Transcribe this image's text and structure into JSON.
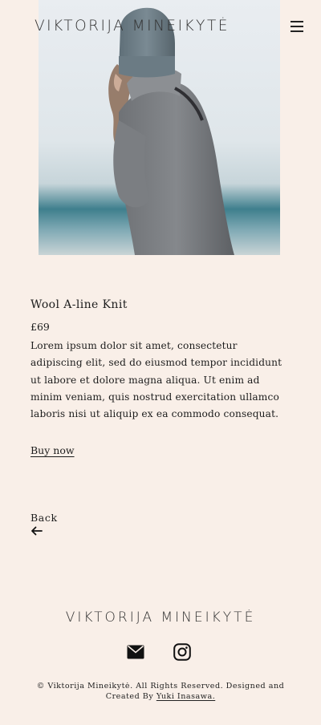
{
  "header": {
    "brand": "VIKTORIJA MINEIKYTĖ",
    "menu_icon": "hamburger-menu-icon"
  },
  "product": {
    "image_alt": "Person wearing a grey wool knit and beanie",
    "title": "Wool A-line Knit",
    "price": "£69",
    "description": "Lorem ipsum dolor sit amet, consectetur adipiscing elit, sed do eiusmod tempor incididunt ut labore et dolore magna aliqua. Ut enim ad minim veniam, quis nostrud exercitation ullamco laboris nisi ut aliquip ex ea commodo consequat.",
    "buy_label": "Buy now"
  },
  "back": {
    "label": "Back",
    "icon": "arrow-left-icon"
  },
  "footer": {
    "brand": "VIKTORIJA MINEIKYTĖ",
    "icons": [
      "envelope-icon",
      "instagram-icon"
    ],
    "copyright_text": "© Viktorija Mineikytė. All Rights Reserved. Designed and Created By",
    "credit_link": "Yuki Inasawa."
  },
  "colors": {
    "background": "#f9efe8",
    "text": "#1c1c1c"
  }
}
